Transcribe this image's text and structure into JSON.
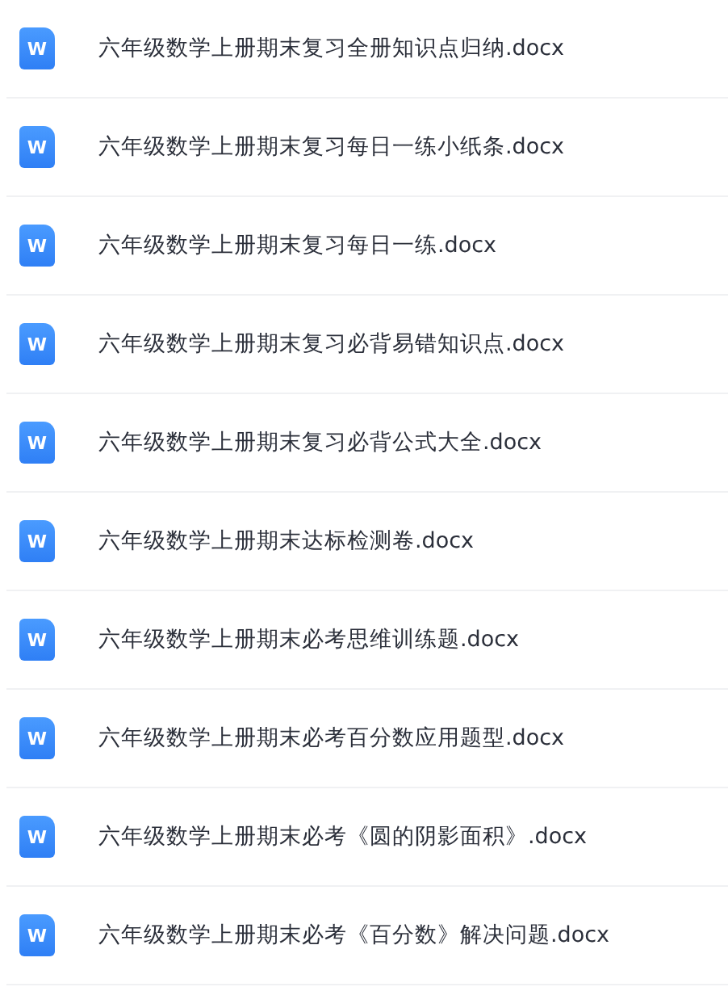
{
  "files": [
    {
      "icon_letter": "W",
      "name": "六年级数学上册期末复习全册知识点归纳.docx"
    },
    {
      "icon_letter": "W",
      "name": "六年级数学上册期末复习每日一练小纸条.docx"
    },
    {
      "icon_letter": "W",
      "name": "六年级数学上册期末复习每日一练.docx"
    },
    {
      "icon_letter": "W",
      "name": "六年级数学上册期末复习必背易错知识点.docx"
    },
    {
      "icon_letter": "W",
      "name": "六年级数学上册期末复习必背公式大全.docx"
    },
    {
      "icon_letter": "W",
      "name": "六年级数学上册期末达标检测卷.docx"
    },
    {
      "icon_letter": "W",
      "name": "六年级数学上册期末必考思维训练题.docx"
    },
    {
      "icon_letter": "W",
      "name": "六年级数学上册期末必考百分数应用题型.docx"
    },
    {
      "icon_letter": "W",
      "name": "六年级数学上册期末必考《圆的阴影面积》.docx"
    },
    {
      "icon_letter": "W",
      "name": "六年级数学上册期末必考《百分数》解决问题.docx"
    }
  ]
}
